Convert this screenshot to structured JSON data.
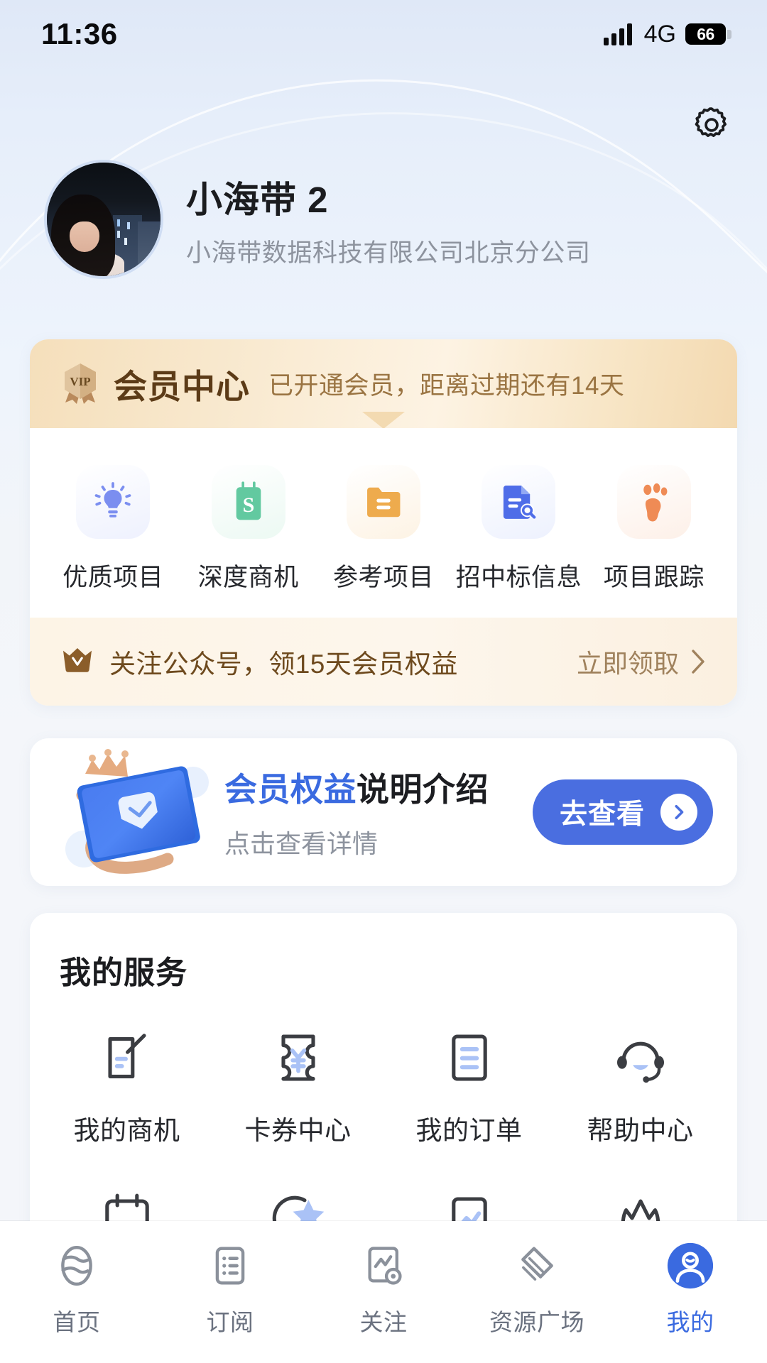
{
  "status_bar": {
    "time": "11:36",
    "network": "4G",
    "battery_percent": "66",
    "signal_icon": "signal-bars-icon",
    "battery_icon": "battery-icon"
  },
  "header": {
    "settings_icon": "gear-icon",
    "avatar_name": "avatar",
    "user_name": "小海带 2",
    "organization": "小海带数据科技有限公司北京分公司"
  },
  "membership_card": {
    "badge_icon": "vip-badge-icon",
    "badge_text": "VIP",
    "title": "会员中心",
    "subtitle": "已开通会员，距离过期还有14天",
    "shortcuts": [
      {
        "label": "优质项目",
        "icon": "lightbulb-icon",
        "color": "#7b8ef0",
        "bg": "#f1f3fe"
      },
      {
        "label": "深度商机",
        "icon": "money-calendar-icon",
        "color": "#62c9a0",
        "bg": "#eefaf5"
      },
      {
        "label": "参考项目",
        "icon": "folder-icon",
        "color": "#eeab4d",
        "bg": "#fdf4e6"
      },
      {
        "label": "招中标信息",
        "icon": "document-search-icon",
        "color": "#4f6de8",
        "bg": "#eef2fe"
      },
      {
        "label": "项目跟踪",
        "icon": "footprint-icon",
        "color": "#ef8b55",
        "bg": "#fdf0e9"
      }
    ],
    "promo": {
      "icon": "crown-icon",
      "text": "关注公众号，领15天会员权益",
      "action_label": "立即领取",
      "action_icon": "chevron-right-icon"
    }
  },
  "benefits_banner": {
    "art_icon": "crowned-card-icon",
    "title_highlight": "会员权益",
    "title_rest": "说明介绍",
    "subtitle": "点击查看详情",
    "button_label": "去查看",
    "button_icon": "arrow-right-circle-icon",
    "button_color": "#4a6ee0"
  },
  "services": {
    "heading": "我的服务",
    "items": [
      {
        "label": "我的商机",
        "icon": "edit-document-icon"
      },
      {
        "label": "卡券中心",
        "icon": "coupon-yen-icon"
      },
      {
        "label": "我的订单",
        "icon": "order-list-icon"
      },
      {
        "label": "帮助中心",
        "icon": "headset-icon"
      },
      {
        "label": "",
        "icon": "calendar-icon"
      },
      {
        "label": "",
        "icon": "star-badge-icon"
      },
      {
        "label": "",
        "icon": "chart-document-icon"
      },
      {
        "label": "",
        "icon": "shield-user-icon"
      }
    ]
  },
  "tab_bar": {
    "active_index": 4,
    "accent_color": "#3a6ae0",
    "items": [
      {
        "label": "首页",
        "icon": "home-globe-icon"
      },
      {
        "label": "订阅",
        "icon": "subscribe-list-icon"
      },
      {
        "label": "关注",
        "icon": "follow-chart-icon"
      },
      {
        "label": "资源广场",
        "icon": "resource-layers-icon"
      },
      {
        "label": "我的",
        "icon": "profile-user-icon"
      }
    ]
  }
}
